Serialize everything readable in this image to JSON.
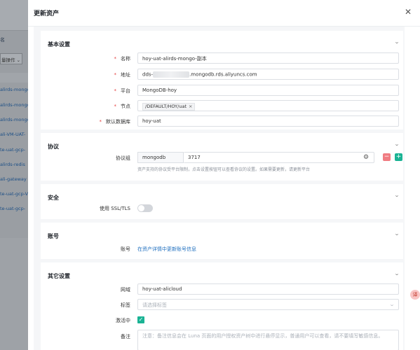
{
  "background": {
    "tab_label": "名",
    "ops_label": "量操作",
    "rows": [
      "alirds-mongo",
      "alirds-mongo",
      "alirds-mongo",
      "ali-VM-UAT-",
      "te-uat-gcp-",
      "alirds-redis",
      "ali-gateway",
      "te-uat-gcp-V",
      "te-uat-gcp-"
    ]
  },
  "drawer": {
    "title": "更新资产",
    "close_icon": "✕"
  },
  "basic": {
    "title": "基本设置",
    "name_label": "名称",
    "name_value": "hoy-uat-alirds-mongo-副本",
    "address_label": "地址",
    "address_prefix": "dds-",
    "address_suffix": ".mongodb.rds.aliyuncs.com",
    "platform_label": "平台",
    "platform_value": "MongoDB-hoy",
    "node_label": "节点",
    "node_tag": "/DEFAULT/HOY/uat",
    "node_tag_close": "×",
    "db_label": "默认数据库",
    "db_value": "hoy-uat"
  },
  "protocol": {
    "title": "协议",
    "label": "协议组",
    "name": "mongodb",
    "port": "3717",
    "remove": "−",
    "add": "+",
    "help": "资产支持的协议受平台限制，点击设置按钮可以查看协议的设置。如果需要更新，请更新平台"
  },
  "security": {
    "title": "安全",
    "ssl_label": "使用 SSL/TLS",
    "ssl_enabled": false
  },
  "account": {
    "title": "账号",
    "label": "账号",
    "link": "在资产详情中更新账号信息"
  },
  "other": {
    "title": "其它设置",
    "domain_label": "网域",
    "domain_value": "hoy-uat-alicloud",
    "tags_label": "标签",
    "tags_placeholder": "请选择标签",
    "active_label": "激活中",
    "active": true,
    "comment_label": "备注",
    "comment_placeholder": "注意：备注信息会在 Luna 页面的用户授权资产树中进行悬停显示，普通用户可以查看，请不要填写敏感信息。"
  },
  "float_button": "译",
  "icons": {
    "chevron": "chevron-down-icon",
    "gear": "gear-icon",
    "close": "close-icon"
  },
  "colors": {
    "accent": "#1ab394",
    "danger": "#f07c82",
    "link": "#1f6fbf",
    "required": "#e53e3e"
  }
}
